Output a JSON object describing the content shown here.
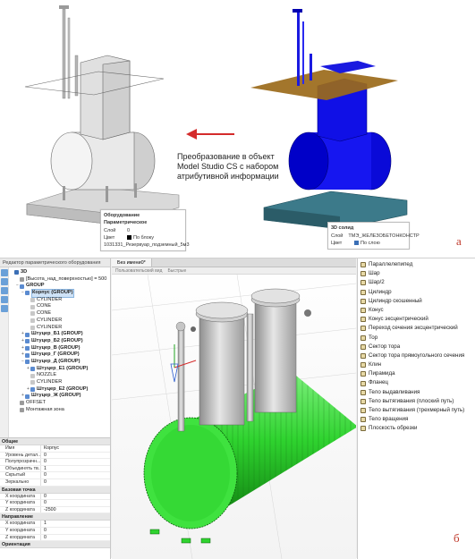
{
  "fig_a": {
    "conversion_text": "Преобразование в объект Model Studio CS с набором атрибутивной информации",
    "left_caption": {
      "title": "Оборудование Параметрическое",
      "layer_key": "Слой",
      "layer_value": "0",
      "color_key": "Цвет",
      "color_value": "По блоку",
      "name_value": "1031331_Резервуар_подземный_5м3"
    },
    "right_caption": {
      "title": "3D солид",
      "layer_key": "Слой",
      "layer_value": "ТМЭ_ЖЕЛЕЗОБЕТОНКОНСТР",
      "color_key": "Цвет",
      "color_value": "По слою"
    },
    "label": "а"
  },
  "fig_b": {
    "label": "б",
    "tree_panel_title": "Редактор параметрического оборудования",
    "tree": [
      {
        "level": 0,
        "exp": "",
        "label": "3D",
        "bold": true,
        "icon": "#3b6fb6"
      },
      {
        "level": 1,
        "exp": "",
        "label": "[Высота_над_поверхностью] = 500",
        "bold": false,
        "icon": "#9a9a9a"
      },
      {
        "level": 1,
        "exp": "−",
        "label": "GROUP",
        "bold": true,
        "icon": "#5b8bd0"
      },
      {
        "level": 2,
        "exp": "−",
        "label": "Корпус (GROUP)",
        "bold": true,
        "icon": "#5b8bd0",
        "selected": true
      },
      {
        "level": 3,
        "exp": "",
        "label": "CYLINDER",
        "bold": false,
        "icon": "#c8c8c8"
      },
      {
        "level": 3,
        "exp": "",
        "label": "CONE",
        "bold": false,
        "icon": "#c8c8c8"
      },
      {
        "level": 3,
        "exp": "",
        "label": "CONE",
        "bold": false,
        "icon": "#c8c8c8"
      },
      {
        "level": 3,
        "exp": "",
        "label": "CYLINDER",
        "bold": false,
        "icon": "#c8c8c8"
      },
      {
        "level": 3,
        "exp": "",
        "label": "CYLINDER",
        "bold": false,
        "icon": "#c8c8c8"
      },
      {
        "level": 2,
        "exp": "+",
        "label": "Штуцер_Б1 (GROUP)",
        "bold": true,
        "icon": "#5b8bd0"
      },
      {
        "level": 2,
        "exp": "+",
        "label": "Штуцер_Б2 (GROUP)",
        "bold": true,
        "icon": "#5b8bd0"
      },
      {
        "level": 2,
        "exp": "+",
        "label": "Штуцер_В (GROUP)",
        "bold": true,
        "icon": "#5b8bd0"
      },
      {
        "level": 2,
        "exp": "+",
        "label": "Штуцер_Г (GROUP)",
        "bold": true,
        "icon": "#5b8bd0"
      },
      {
        "level": 2,
        "exp": "−",
        "label": "Штуцер_Д (GROUP)",
        "bold": true,
        "icon": "#5b8bd0"
      },
      {
        "level": 3,
        "exp": "+",
        "label": "Штуцер_Е1 (GROUP)",
        "bold": true,
        "icon": "#5b8bd0"
      },
      {
        "level": 3,
        "exp": "",
        "label": "NOZZLE",
        "bold": false,
        "icon": "#c8c8c8"
      },
      {
        "level": 3,
        "exp": "",
        "label": "CYLINDER",
        "bold": false,
        "icon": "#c8c8c8"
      },
      {
        "level": 3,
        "exp": "+",
        "label": "Штуцер_Е2 (GROUP)",
        "bold": true,
        "icon": "#5b8bd0"
      },
      {
        "level": 2,
        "exp": "+",
        "label": "Штуцер_Ж (GROUP)",
        "bold": true,
        "icon": "#5b8bd0"
      },
      {
        "level": 1,
        "exp": "",
        "label": "OFFSET",
        "bold": false,
        "icon": "#9a9a9a"
      },
      {
        "level": 1,
        "exp": "",
        "label": "Монтажная зона",
        "bold": false,
        "icon": "#9a9a9a"
      }
    ],
    "props": [
      {
        "section": "Общие"
      },
      {
        "k": "Имя",
        "v": "Корпус"
      },
      {
        "k": "Уровень детал...",
        "v": "0"
      },
      {
        "k": "Полупрозрачн...",
        "v": "0"
      },
      {
        "k": "Объединять тв...",
        "v": "1"
      },
      {
        "k": "Скрытый",
        "v": "0"
      },
      {
        "k": "Зеркально",
        "v": "0"
      },
      {
        "section": "Базовая точка"
      },
      {
        "k": "X координата",
        "v": "0"
      },
      {
        "k": "Y координата",
        "v": "0"
      },
      {
        "k": "Z координата",
        "v": "-2500"
      },
      {
        "section": "Направление"
      },
      {
        "k": "X координата",
        "v": "1"
      },
      {
        "k": "Y координата",
        "v": "0"
      },
      {
        "k": "Z координата",
        "v": "0"
      },
      {
        "section": "Ориентация"
      }
    ],
    "viewport": {
      "tab_label": "Без имени0*",
      "bar_items": [
        "Пользовательский вид",
        "Быстрые"
      ]
    },
    "primitives": [
      "Параллелепипед",
      "Шар",
      "Шар/2",
      "Цилиндр",
      "Цилиндр скошенный",
      "Конус",
      "Конус эксцентрический",
      "Переход сечения эксцентрический",
      "Тор",
      "Сектор тора",
      "Сектор тора прямоугольного сечения",
      "Клин",
      "Пирамида",
      "Фланец",
      "Тело выдавливания",
      "Тело вытягивания (плоский путь)",
      "Тело вытягивания (трехмерный путь)",
      "Тело вращения",
      "Плоскость обрезки"
    ],
    "colors": {
      "green_shell": "#2fd32f",
      "green_dark": "#1a8f1a",
      "pipe_gray": "#b9b9b9"
    }
  }
}
